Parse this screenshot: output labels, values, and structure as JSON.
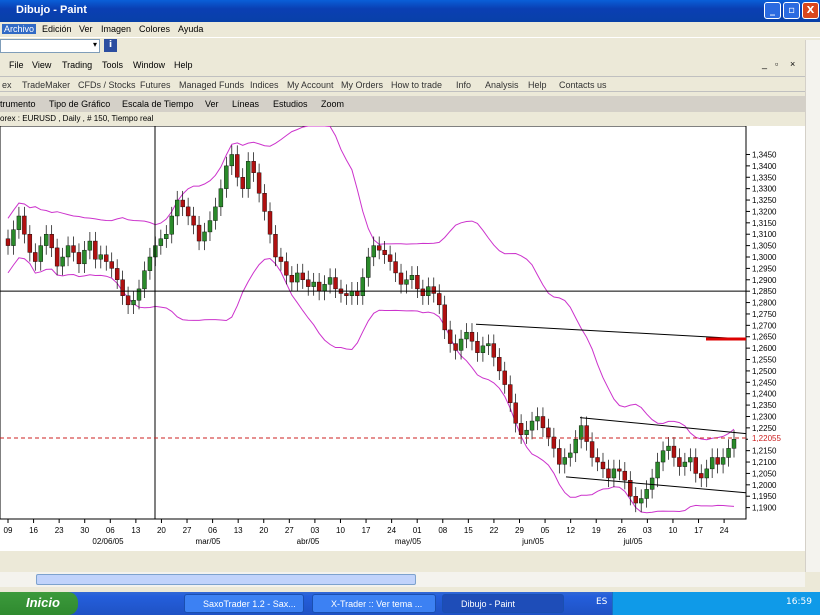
{
  "window": {
    "title": "Dibujo - Paint",
    "controls": [
      "_",
      "▫",
      "X"
    ]
  },
  "menu": [
    "Archivo",
    "Edición",
    "Ver",
    "Imagen",
    "Colores",
    "Ayuda"
  ],
  "app_menu": [
    "File",
    "View",
    "Trading",
    "Tools",
    "Window",
    "Help"
  ],
  "nav": [
    "ex",
    "TradeMaker",
    "CFDs / Stocks",
    "Futures",
    "Managed Funds",
    "Indices",
    "My Account",
    "My Orders",
    "How to trade",
    "Info",
    "Analysis",
    "Help",
    "Contacts us"
  ],
  "chart_menu": [
    "trumento",
    "Tipo de Gráfico",
    "Escala de Tiempo",
    "Ver",
    "Líneas",
    "Estudios",
    "Zoom"
  ],
  "chart_subtitle": "orex : EURUSD , Daily , # 150, Tiempo real",
  "chart_data": {
    "type": "candlestick",
    "y_ticks": [
      "1,3450",
      "1,3400",
      "1,3350",
      "1,3300",
      "1,3250",
      "1,3200",
      "1,3150",
      "1,3100",
      "1,3050",
      "1,3000",
      "1,2950",
      "1,2900",
      "1,2850",
      "1,2800",
      "1,2750",
      "1,2700",
      "1,2650",
      "1,2600",
      "1,2550",
      "1,2500",
      "1,2450",
      "1,2400",
      "1,2350",
      "1,2300",
      "1,2250",
      "1,2200",
      "1,2150",
      "1,2100",
      "1,2050",
      "1,2000",
      "1,1950",
      "1,1900"
    ],
    "ylim": [
      1.185,
      1.3575
    ],
    "x_ticks": [
      "09",
      "16",
      "23",
      "30",
      "06",
      "13",
      "20",
      "27",
      "06",
      "13",
      "20",
      "27",
      "03",
      "10",
      "17",
      "24",
      "01",
      "08",
      "15",
      "22",
      "29",
      "05",
      "12",
      "19",
      "26",
      "03",
      "10",
      "17",
      "24"
    ],
    "month_labels": [
      "02/06/05",
      "mar/05",
      "abr/05",
      "may/05",
      "jun/05",
      "jul/05"
    ],
    "current_price": "1,22055",
    "crosshair_price": "1,2850",
    "marker_level": 1.264,
    "closes": [
      1.305,
      1.312,
      1.318,
      1.31,
      1.302,
      1.298,
      1.305,
      1.31,
      1.304,
      1.296,
      1.3,
      1.305,
      1.302,
      1.297,
      1.303,
      1.307,
      1.299,
      1.301,
      1.298,
      1.295,
      1.29,
      1.283,
      1.279,
      1.281,
      1.286,
      1.294,
      1.3,
      1.305,
      1.308,
      1.31,
      1.318,
      1.325,
      1.322,
      1.318,
      1.314,
      1.307,
      1.311,
      1.316,
      1.322,
      1.33,
      1.34,
      1.345,
      1.335,
      1.33,
      1.342,
      1.337,
      1.328,
      1.32,
      1.31,
      1.3,
      1.298,
      1.292,
      1.289,
      1.293,
      1.29,
      1.287,
      1.289,
      1.285,
      1.288,
      1.291,
      1.286,
      1.284,
      1.283,
      1.285,
      1.283,
      1.291,
      1.3,
      1.305,
      1.303,
      1.301,
      1.298,
      1.293,
      1.288,
      1.29,
      1.292,
      1.286,
      1.283,
      1.287,
      1.284,
      1.279,
      1.268,
      1.262,
      1.259,
      1.264,
      1.267,
      1.263,
      1.258,
      1.261,
      1.262,
      1.256,
      1.25,
      1.244,
      1.236,
      1.227,
      1.222,
      1.224,
      1.228,
      1.23,
      1.225,
      1.221,
      1.216,
      1.209,
      1.212,
      1.214,
      1.22,
      1.226,
      1.219,
      1.212,
      1.21,
      1.207,
      1.203,
      1.207,
      1.206,
      1.202,
      1.195,
      1.192,
      1.194,
      1.198,
      1.203,
      1.21,
      1.215,
      1.217,
      1.212,
      1.208,
      1.21,
      1.212,
      1.205,
      1.203,
      1.207,
      1.212,
      1.209,
      1.212,
      1.216,
      1.22
    ]
  },
  "taskbar": {
    "start": "Inicio",
    "tasks": [
      "SaxoTrader 1.2 - Sax...",
      "X-Trader :: Ver tema ...",
      "Dibujo - Paint"
    ],
    "lang": "ES",
    "clock": "16:59"
  },
  "colors": {
    "bollinger": "#cc33cc",
    "up": "#2a8a2a",
    "down": "#b01010",
    "marker": "#dd0000",
    "dashed": "#cc2222"
  }
}
